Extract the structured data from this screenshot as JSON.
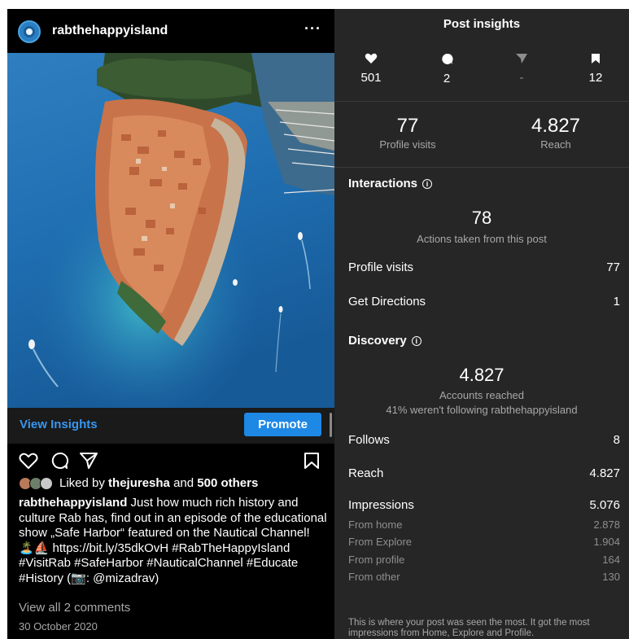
{
  "post": {
    "username": "rabthehappyisland",
    "more_label": "···",
    "view_insights": "View Insights",
    "promote": "Promote",
    "liked_by_prefix": "Liked by",
    "liked_by_user": "thejuresha",
    "liked_by_and": "and",
    "liked_by_others": "500 others",
    "caption_user": "rabthehappyisland",
    "caption_text": "Just how much rich history and culture Rab has, find out in an episode of the educational show „Safe Harbor“ featured on the Nautical Channel! 🏝️⛵ https://bit.ly/35dkOvH #RabTheHappyIsland #VisitRab #SafeHarbor #NauticalChannel #Educate #History (📷: @mizadrav)",
    "view_comments": "View all 2 comments",
    "date": "30 October 2020"
  },
  "insights": {
    "title": "Post insights",
    "likes": "501",
    "comments": "2",
    "shares": "-",
    "saves": "12",
    "profile_visits_num": "77",
    "profile_visits_label": "Profile visits",
    "reach_num": "4.827",
    "reach_label": "Reach",
    "interactions_title": "Interactions",
    "actions_num": "78",
    "actions_label": "Actions taken from this post",
    "rows_interactions": [
      {
        "label": "Profile visits",
        "value": "77"
      },
      {
        "label": "Get Directions",
        "value": "1"
      }
    ],
    "discovery_title": "Discovery",
    "accounts_num": "4.827",
    "accounts_label": "Accounts reached",
    "accounts_sub": "41% weren't following rabthehappyisland",
    "rows_discovery": [
      {
        "label": "Follows",
        "value": "8"
      },
      {
        "label": "Reach",
        "value": "4.827"
      },
      {
        "label": "Impressions",
        "value": "5.076"
      }
    ],
    "rows_impressions": [
      {
        "label": "From home",
        "value": "2.878"
      },
      {
        "label": "From Explore",
        "value": "1.904"
      },
      {
        "label": "From profile",
        "value": "164"
      },
      {
        "label": "From other",
        "value": "130"
      }
    ],
    "footnote": "This is where your post was seen the most. It got the most impressions from Home, Explore and Profile."
  },
  "colors": {
    "accent": "#3897f0",
    "promote": "#1e88e5",
    "panel_dark": "#262626"
  }
}
